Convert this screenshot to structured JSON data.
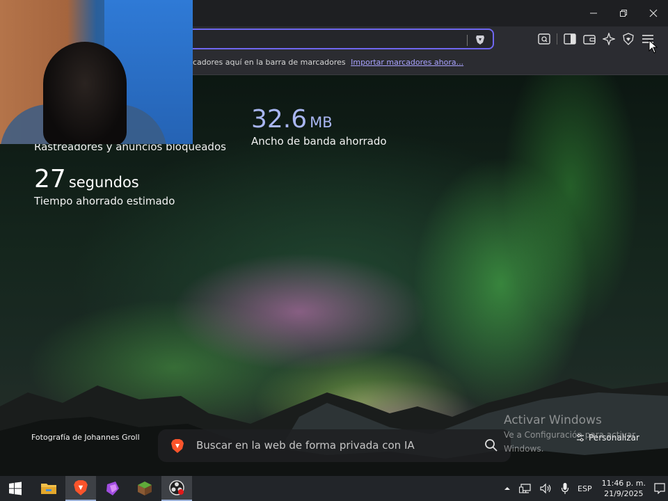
{
  "browser": {
    "bookmarks_bar": {
      "hint_text": "cadores aquí en la barra de marcadores",
      "import_link": "Importar marcadores ahora..."
    },
    "toolbar_icons": [
      "reader-mode-icon",
      "sidebar-icon",
      "wallet-icon",
      "leo-ai-icon",
      "vpn-icon",
      "menu-icon"
    ],
    "accent_color": "#6f67f0"
  },
  "stats": {
    "trackers": {
      "label": "Rastreadores y anuncios bloqueados"
    },
    "bandwidth": {
      "value": "32.6",
      "unit": "MB",
      "label": "Ancho de banda ahorrado"
    },
    "time": {
      "value": "27",
      "unit": "segundos",
      "label": "Tiempo ahorrado estimado"
    }
  },
  "newtab": {
    "photo_credit": "Fotografía de Johannes Groll",
    "search_placeholder": "Buscar en la web de forma privada con IA",
    "customize_label": "Personalizar"
  },
  "watermark": {
    "title": "Activar Windows",
    "line1": "Ve a Configuración para activar",
    "line2": "Windows."
  },
  "taskbar": {
    "apps": [
      "windows-start",
      "file-explorer",
      "brave-browser",
      "purple-app",
      "minecraft",
      "obs-studio"
    ],
    "language": "ESP",
    "time": "11:46 p. m.",
    "date": "21/9/2025"
  }
}
